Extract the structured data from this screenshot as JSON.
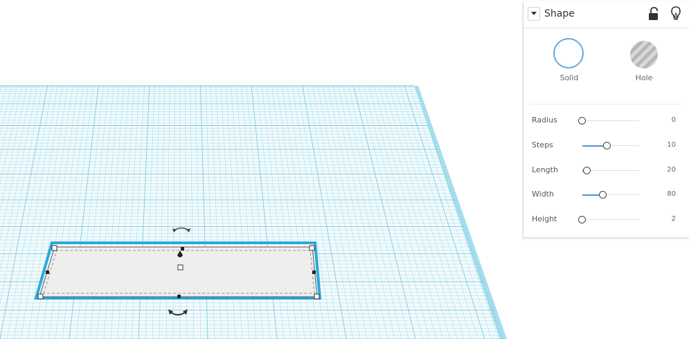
{
  "inspector": {
    "title": "Shape",
    "types": [
      {
        "label": "Solid",
        "selected": true
      },
      {
        "label": "Hole",
        "selected": false
      }
    ],
    "params": [
      {
        "label": "Radius",
        "value": "0",
        "level": 0.0
      },
      {
        "label": "Steps",
        "value": "10",
        "level": 0.44
      },
      {
        "label": "Length",
        "value": "20",
        "level": 0.08
      },
      {
        "label": "Width",
        "value": "80",
        "level": 0.36
      },
      {
        "label": "Height",
        "value": "2",
        "level": 0.0
      }
    ]
  },
  "colors": {
    "grid_line": "#9fd8e6",
    "grid_major": "#7dc8dd",
    "plane_edge": "#5cc3e0",
    "shape_fill": "#eeeeee",
    "selection_outline": "#2aa9dd",
    "slider_fill": "#5b8fc7",
    "solid_ring": "#6aa7d8"
  },
  "icons": [
    "collapse-icon",
    "lock-icon",
    "bulb-icon",
    "rotate-top-icon",
    "rotate-bottom-icon",
    "lift-icon"
  ]
}
